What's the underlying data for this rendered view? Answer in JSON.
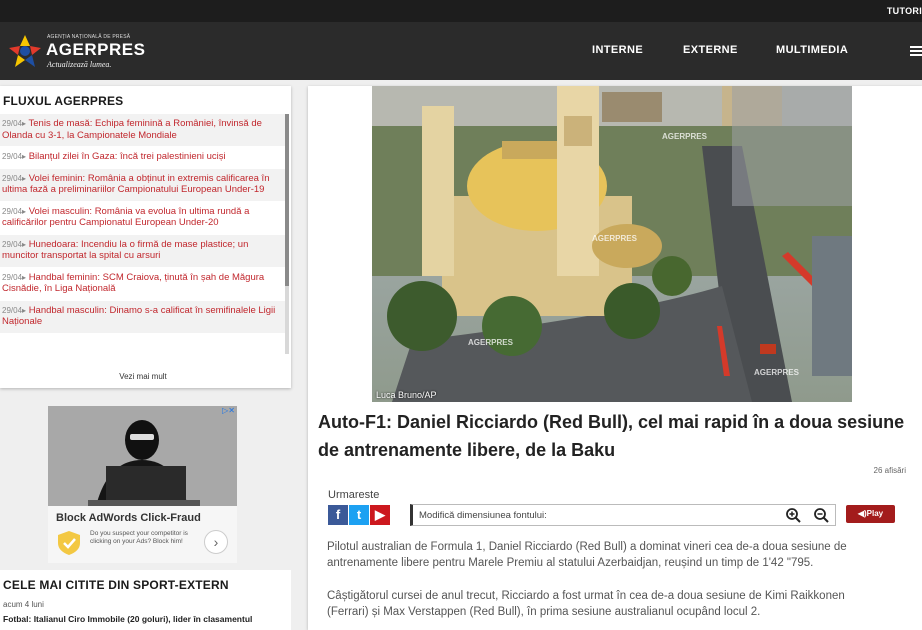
{
  "topbar": {
    "link": "TUTORI"
  },
  "header": {
    "logo_small": "AGENȚIA NAȚIONALĂ DE PRESĂ",
    "logo_name": "AGERPRES",
    "logo_tagline": "Actualizează lumea.",
    "nav": [
      "INTERNE",
      "EXTERNE",
      "MULTIMEDIA"
    ]
  },
  "flux": {
    "title": "FLUXUL AGERPRES",
    "items": [
      {
        "date": "29/04",
        "text": "Tenis de masă: Echipa feminină a României, învinsă de Olanda cu 3-1, la Campionatele Mondiale"
      },
      {
        "date": "29/04",
        "text": "Bilanțul zilei în Gaza: încă trei palestinieni uciși"
      },
      {
        "date": "29/04",
        "text": "Volei feminin: România a obținut in extremis calificarea în ultima fază a preliminariilor Campionatului European Under-19"
      },
      {
        "date": "29/04",
        "text": "Volei masculin: România va evolua în ultima rundă a calificărilor pentru Campionatul European Under-20"
      },
      {
        "date": "29/04",
        "text": "Hunedoara: Incendiu la o firmă de mase plastice; un muncitor transportat la spital cu arsuri"
      },
      {
        "date": "29/04",
        "text": "Handbal feminin: SCM Craiova, ținută în șah de Măgura Cisnădie, în Liga Națională"
      },
      {
        "date": "29/04",
        "text": "Handbal masculin: Dinamo s-a calificat în semifinalele Ligii Naționale"
      }
    ],
    "more": "Vezi mai mult"
  },
  "ad": {
    "choices": "▷✕",
    "title": "Block AdWords Click-Fraud",
    "desc": "Do you suspect your competitor is clicking on your Ads? Block him!",
    "cta": "›"
  },
  "popular": {
    "title": "CELE MAI CITITE DIN SPORT-EXTERN",
    "ago": "acum 4 luni",
    "headline": "Fotbal: Italianul Ciro Immobile (20 goluri), lider în clasamentul"
  },
  "article": {
    "photo_credit": "Luca Bruno/AP",
    "watermark": "AGERPRES",
    "title": "Auto-F1: Daniel Ricciardo (Red Bull), cel mai rapid în a doua sesiune de antrenamente libere, de la Baku",
    "views": "26 afisări",
    "follow_label": "Urmareste",
    "font_label": "Modifică dimensiunea fontului:",
    "play_label": "◀)Play",
    "paragraphs": [
      "Pilotul australian de Formula 1, Daniel Ricciardo (Red Bull) a dominat vineri cea de-a doua sesiune de antrenamente libere pentru Marele Premiu al statului Azerbaidjan, reușind un timp de 1'42 \"795.",
      "Câștigătorul cursei de anul trecut, Ricciardo a fost urmat în cea de-a doua sesiune de Kimi Raikkonen (Ferrari) și Max Verstappen (Red Bull), în prima sesiune australianul ocupând locul 2."
    ]
  },
  "colors": {
    "accent_red": "#c1272d",
    "header_bg": "#2b2b2b",
    "facebook": "#3b5998",
    "twitter": "#1da1f2",
    "youtube": "#cc181e"
  }
}
